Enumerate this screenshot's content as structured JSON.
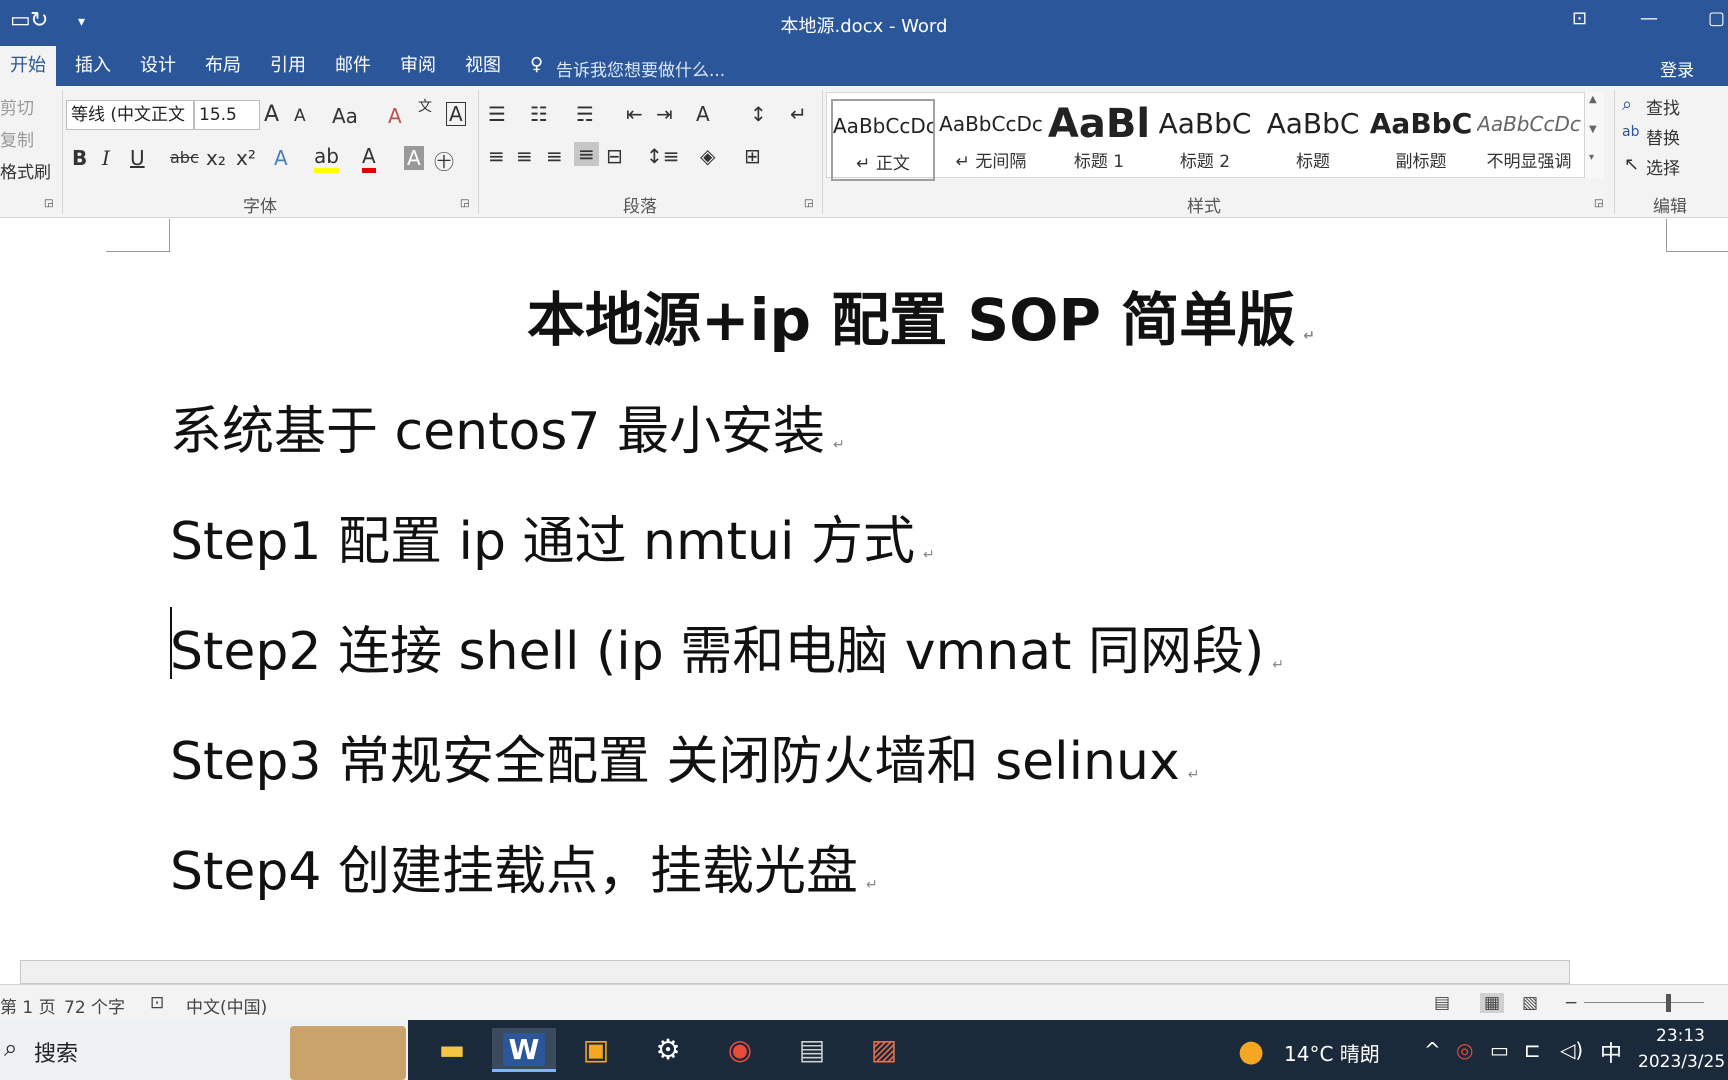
{
  "window": {
    "title": "本地源.docx - Word"
  },
  "tabs": [
    {
      "label": "开始"
    },
    {
      "label": "插入"
    },
    {
      "label": "设计"
    },
    {
      "label": "布局"
    },
    {
      "label": "引用"
    },
    {
      "label": "邮件"
    },
    {
      "label": "审阅"
    },
    {
      "label": "视图"
    }
  ],
  "tell_me": "告诉我您想要做什么...",
  "signin": "登录",
  "clipboard": {
    "cut": "剪切",
    "copy": "复制",
    "format_painter": "格式刷"
  },
  "font": {
    "name": "等线 (中文正文",
    "size": "15.5",
    "group_label": "字体"
  },
  "paragraph": {
    "group_label": "段落"
  },
  "styles": {
    "group_label": "样式",
    "items": [
      {
        "sample": "AaBbCcDc",
        "name": "↵ 正文"
      },
      {
        "sample": "AaBbCcDc",
        "name": "↵ 无间隔"
      },
      {
        "sample": "AaBl",
        "name": "标题 1"
      },
      {
        "sample": "AaBbC",
        "name": "标题 2"
      },
      {
        "sample": "AaBbC",
        "name": "标题"
      },
      {
        "sample": "AaBbC",
        "name": "副标题"
      },
      {
        "sample": "AaBbCcDc",
        "name": "不明显强调"
      }
    ]
  },
  "editing": {
    "find": "查找",
    "replace": "替换",
    "select": "选择",
    "group_label": "编辑"
  },
  "document": {
    "title": "本地源+ip 配置  SOP 简单版",
    "paragraphs": [
      "系统基于 centos7 最小安装",
      "Step1 配置 ip  通过 nmtui 方式",
      "Step2 连接 shell (ip 需和电脑 vmnat 同网段)",
      "Step3  常规安全配置  关闭防火墙和 selinux",
      "Step4  创建挂载点，挂载光盘"
    ]
  },
  "statusbar": {
    "page": "第 1 页",
    "words": "72 个字",
    "language": "中文(中国)"
  },
  "taskbar": {
    "search": "搜索",
    "weather": "14°C  晴朗",
    "ime": "中",
    "time": "23:13",
    "date": "2023/3/25"
  }
}
